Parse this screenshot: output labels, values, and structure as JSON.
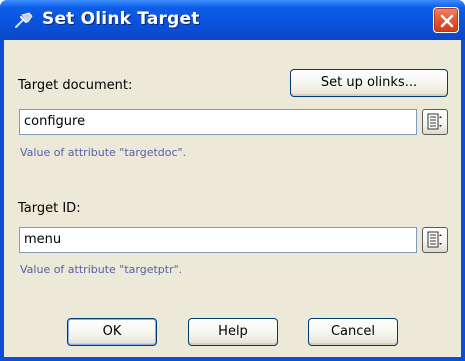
{
  "window": {
    "title": "Set Olink Target",
    "icon": "pin-icon",
    "close_icon": "close-icon"
  },
  "target_document": {
    "label": "Target document:",
    "setup_button_label": "Set up olinks...",
    "value": "configure",
    "hint": "Value of attribute \"targetdoc\".",
    "picker_icon": "list-picker-icon"
  },
  "target_id": {
    "label": "Target ID:",
    "value": "menu",
    "hint": "Value of attribute \"targetptr\".",
    "picker_icon": "list-picker-icon"
  },
  "buttons": {
    "ok_label": "OK",
    "help_label": "Help",
    "cancel_label": "Cancel"
  },
  "colors": {
    "titlebar": "#0a52dc",
    "client_bg": "#ece9d8",
    "hint_text": "#5860a8",
    "close_button": "#e25a36"
  }
}
